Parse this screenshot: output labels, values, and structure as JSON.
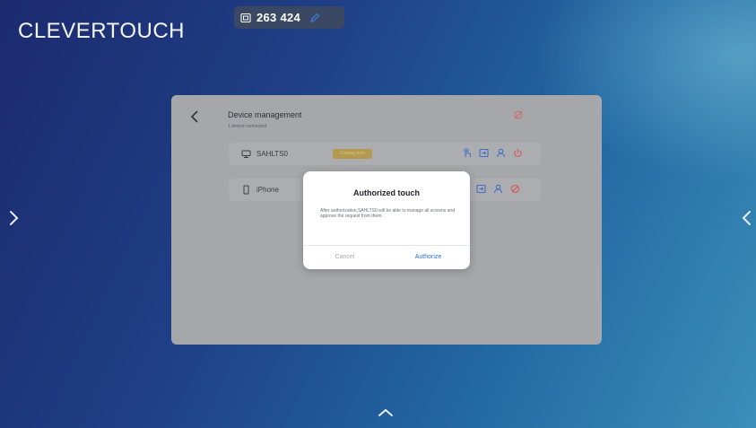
{
  "brand": {
    "logo_text": "CLEVERTOUCH"
  },
  "connection": {
    "code": "263 424",
    "cast_icon": "cast-screen-icon",
    "edit_icon": "pencil-icon"
  },
  "navigation": {
    "left_arrow_icon": "chevron-right-icon",
    "right_arrow_icon": "chevron-left-icon",
    "bottom_arrow_icon": "chevron-up-icon"
  },
  "device_management": {
    "title": "Device management",
    "subtitle": "1 device connected",
    "close_icon": "unlink-icon",
    "devices": [
      {
        "name": "SAHLTS0",
        "type_icon": "laptop-icon",
        "status": "Casting now",
        "actions": [
          "touch-icon",
          "screen-share-icon",
          "user-icon",
          "power-icon"
        ]
      },
      {
        "name": "iPhone",
        "type_icon": "phone-icon",
        "status": "",
        "actions": [
          "screen-share-icon",
          "user-icon",
          "disconnect-icon"
        ]
      }
    ]
  },
  "dialog": {
    "title": "Authorized touch",
    "body": "After authorization,SAHLTS0 will be able to manage all screens and approve the request from them.",
    "cancel_label": "Cancel",
    "confirm_label": "Authorize"
  },
  "colors": {
    "accent_blue": "#2f6fde",
    "danger_red": "#d9534f",
    "icon_blue": "#3f6fc6",
    "status_amber": "#b39a50",
    "overlay_gray": "#a5a7aa"
  }
}
